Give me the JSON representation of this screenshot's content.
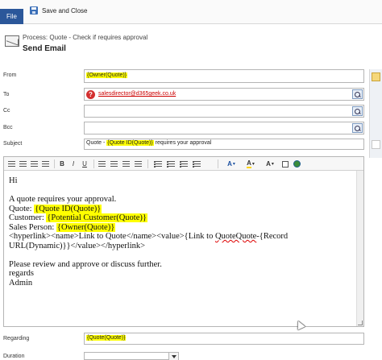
{
  "ribbon": {
    "file_label": "File",
    "save_close_label": "Save and Close"
  },
  "header": {
    "process": "Process: Quote - Check if requires approval",
    "title": "Send Email"
  },
  "form": {
    "from": {
      "label": "From",
      "value": "{Owner(Quote)}"
    },
    "to": {
      "label": "To",
      "value": "salesdirector@d365geek.co.uk"
    },
    "cc": {
      "label": "Cc",
      "value": ""
    },
    "bcc": {
      "label": "Bcc",
      "value": ""
    },
    "subject": {
      "label": "Subject",
      "prefix": "Quote - ",
      "token": "{Quote ID(Quote)}",
      "suffix": " requires your approval"
    },
    "regarding": {
      "label": "Regarding",
      "value": "{Quote(Quote)}"
    },
    "duration": {
      "label": "Duration"
    }
  },
  "toolbar": {
    "bold": "B",
    "italic": "I",
    "underline": "U",
    "font_color": "A",
    "highlight": "A",
    "font_size": "A",
    "link": "link-icon",
    "image": "image-icon"
  },
  "body": {
    "greeting": "Hi",
    "intro": "A quote requires your approval.",
    "quote_label": "Quote:",
    "quote_token": "{Quote ID(Quote)}",
    "customer_label": "Customer:",
    "customer_token": "{Potential Customer(Quote)}",
    "salesperson_label": "Sales Person:",
    "salesperson_token": "{Owner(Quote)}",
    "hyperlink_1_pre": "<hyperlink><name>Link to Quote</name><value>{Link to ",
    "hyperlink_1_squiggle": "QuoteQuote",
    "hyperlink_1_post": "-{Record",
    "hyperlink_2": "URL(Dynamic)}}</value></hyperlink>",
    "review": "Please review and approve or discuss further.",
    "regards": "regards",
    "signature": "Admin"
  }
}
